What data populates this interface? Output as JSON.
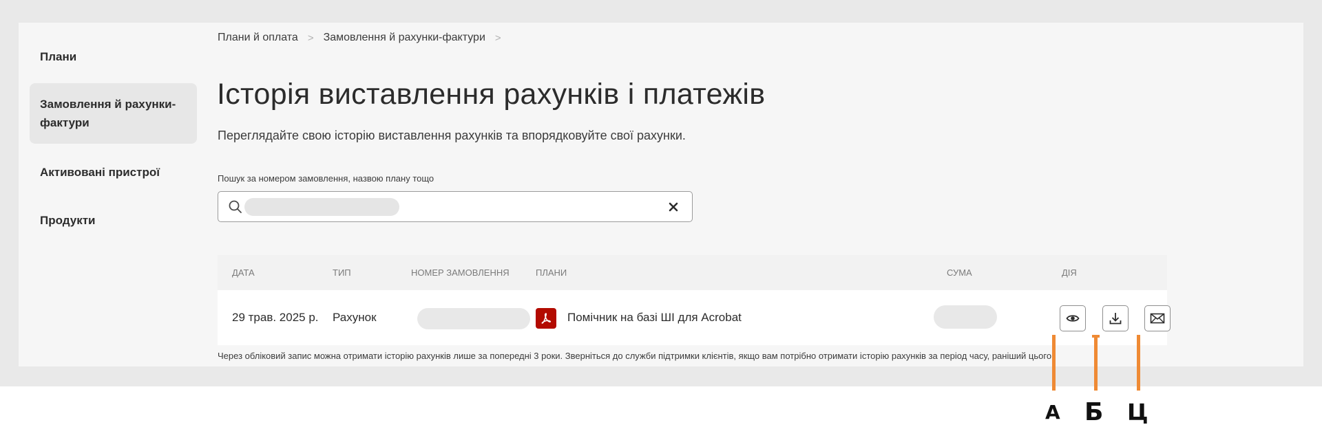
{
  "sidebar": {
    "items": [
      {
        "label": "Плани"
      },
      {
        "label_line1": "Замовлення й рахунки-",
        "label_line2": "фактури"
      },
      {
        "label": "Активовані пристрої"
      },
      {
        "label": "Продукти"
      }
    ]
  },
  "breadcrumb": [
    "Плани й оплата",
    "Замовлення й рахунки-фактури"
  ],
  "breadcrumb_separator": ">",
  "page": {
    "title": "Історія виставлення рахунків і платежів",
    "subtitle": "Переглядайте свою історію виставлення рахунків та впорядковуйте свої рахунки."
  },
  "search": {
    "label": "Пошук за номером замовлення, назвою плану тощо",
    "clear_symbol": "✕"
  },
  "table": {
    "headers": {
      "date": "ДАТА",
      "type": "ТИП",
      "order_number": "НОМЕР ЗАМОВЛЕННЯ",
      "plans": "ПЛАНИ",
      "amount": "СУМА",
      "action": "ДІЯ"
    },
    "rows": [
      {
        "date": "29 трав. 2025 р.",
        "type": "Рахунок",
        "plan": "Помічник на базі ШІ для Acrobat"
      }
    ]
  },
  "footnote": "Через обліковий запис можна отримати історію рахунків лише за попередні 3 роки. Зверніться до служби підтримки клієнтів, якщо вам потрібно отримати історію рахунків за період часу, раніший цього.",
  "callouts": {
    "view": "А",
    "download": "Б",
    "email": "Ц"
  },
  "icons": [
    "search-icon",
    "close-icon",
    "adobe-pdf-icon",
    "eye-icon",
    "download-icon",
    "mail-icon"
  ],
  "colors": {
    "pdf_badge": "#b30b00",
    "callout": "#ef8a34",
    "panel": "#f6f6f6",
    "frame": "#e9e9e9"
  }
}
